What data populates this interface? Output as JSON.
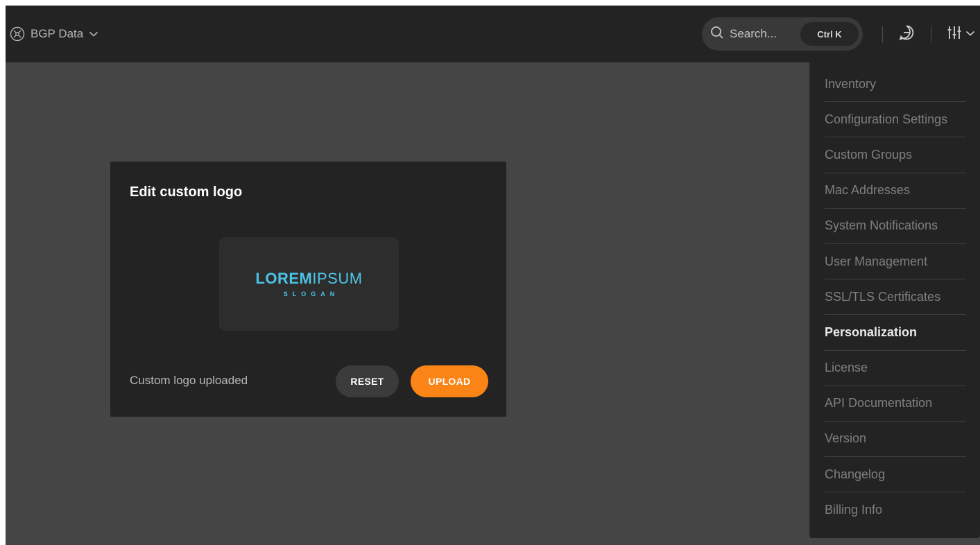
{
  "app": {
    "name": "BGP Data",
    "logo_icon": "globe-icon",
    "dropdown_icon": "chevron-down-icon"
  },
  "header": {
    "search": {
      "placeholder": "Search...",
      "shortcut": "Ctrl K",
      "icon": "search-icon"
    },
    "chat_icon": "chat-icon",
    "settings_icon": "sliders-icon"
  },
  "settings_menu": {
    "items": [
      {
        "label": "Inventory",
        "active": false
      },
      {
        "label": "Configuration Settings",
        "active": false
      },
      {
        "label": "Custom Groups",
        "active": false
      },
      {
        "label": "Mac Addresses",
        "active": false
      },
      {
        "label": "System Notifications",
        "active": false
      },
      {
        "label": "User Management",
        "active": false
      },
      {
        "label": "SSL/TLS Certificates",
        "active": false
      },
      {
        "label": "Personalization",
        "active": true
      },
      {
        "label": "License",
        "active": false
      },
      {
        "label": "API Documentation",
        "active": false
      },
      {
        "label": "Version",
        "active": false
      },
      {
        "label": "Changelog",
        "active": false
      },
      {
        "label": "Billing Info",
        "active": false
      }
    ]
  },
  "logo_card": {
    "title": "Edit custom logo",
    "logo": {
      "bold_text": "LOREM",
      "light_text": "IPSUM",
      "slogan": "SLOGAN"
    },
    "status": "Custom logo uploaded",
    "reset_label": "RESET",
    "upload_label": "UPLOAD"
  },
  "colors": {
    "accent": "#fa8415",
    "logo_blue": "#4cc3e6",
    "panel": "#232323",
    "background": "#454545"
  }
}
